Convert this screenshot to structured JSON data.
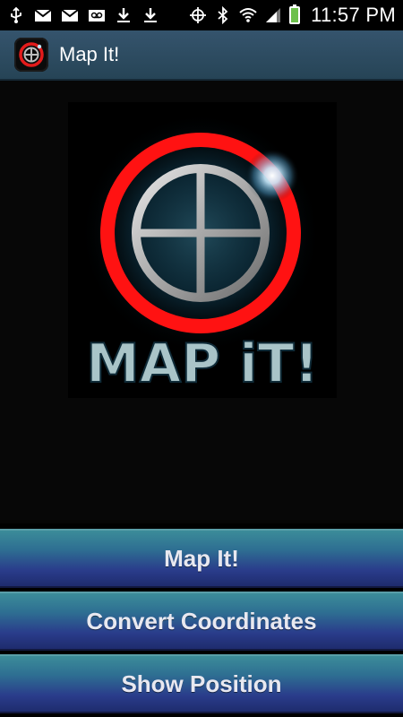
{
  "status_bar": {
    "time": "11:57 PM",
    "icons": [
      "usb-icon",
      "gmail-icon",
      "gmail-icon",
      "voicemail-icon",
      "download-icon",
      "download-icon",
      "gps-icon",
      "bluetooth-icon",
      "wifi-icon",
      "signal-icon",
      "battery-charging-icon"
    ]
  },
  "app_bar": {
    "title": "Map It!",
    "icon": "crosshair-logo-icon"
  },
  "logo": {
    "text": "MAP iT!",
    "colors": {
      "ring": "#ff0000",
      "crosshair": "#b0b0b0",
      "text": "#a9c4c8"
    }
  },
  "buttons": {
    "map_it": "Map It!",
    "convert": "Convert Coordinates",
    "show_position": "Show Position"
  },
  "colors": {
    "app_bar": "#2f4e65",
    "button_top": "#3d8f9a",
    "button_bottom": "#1d2a6a"
  }
}
